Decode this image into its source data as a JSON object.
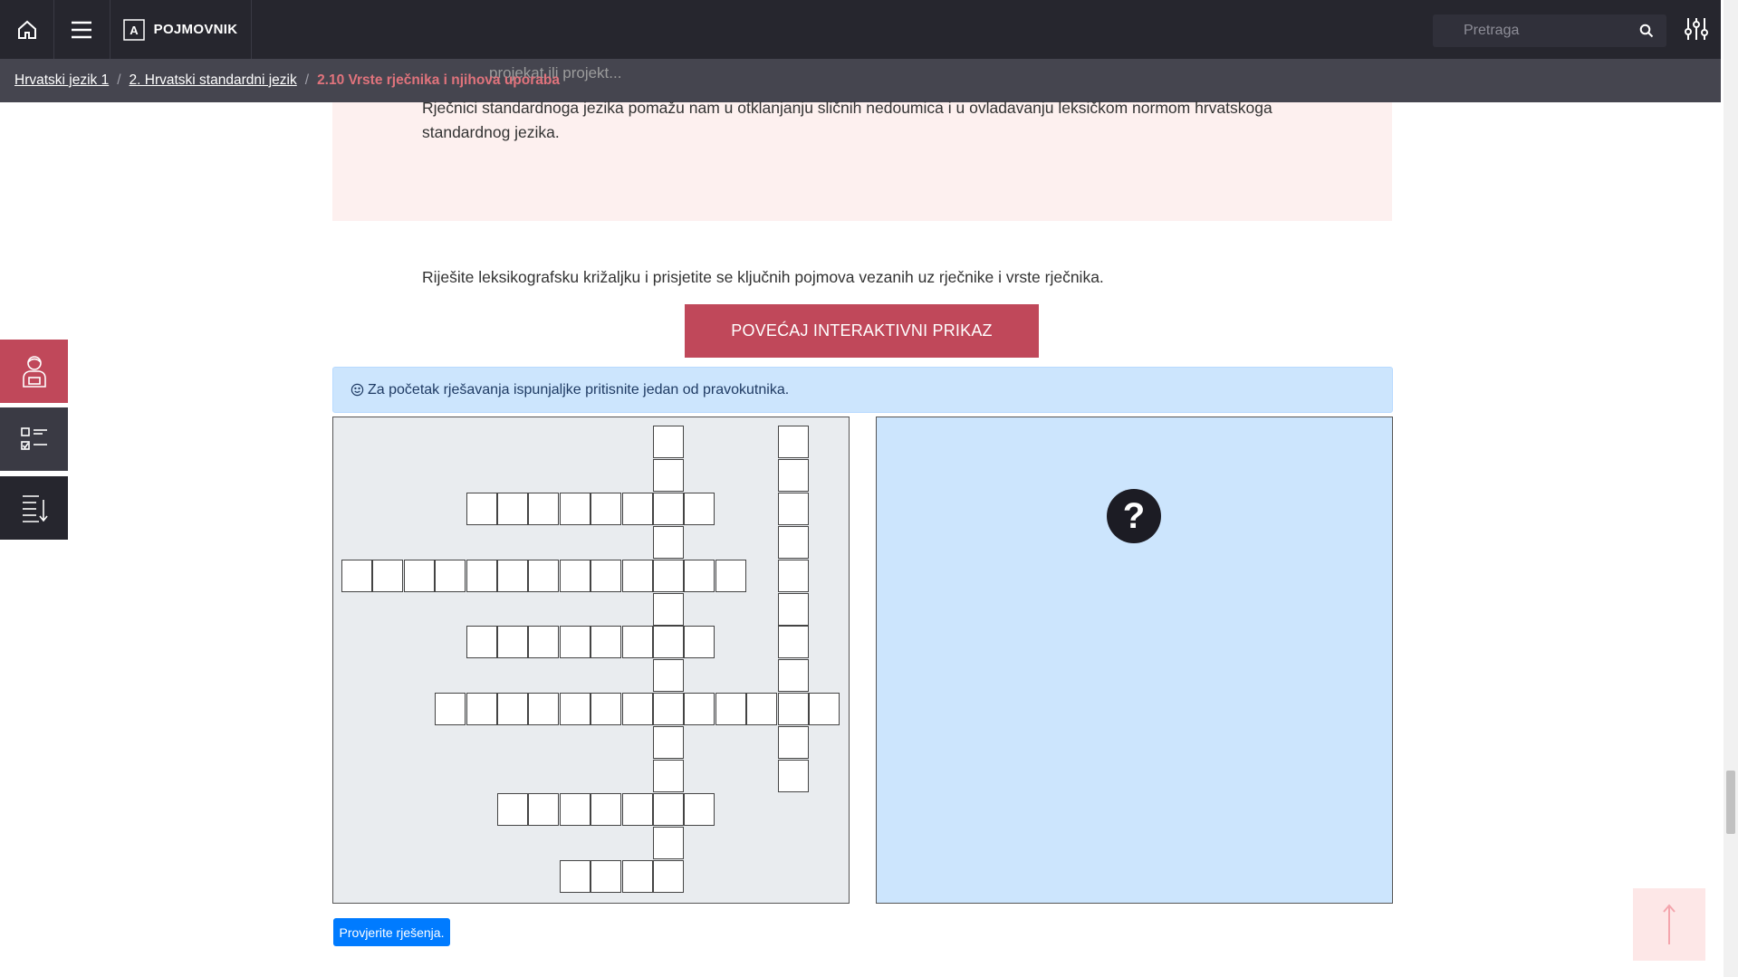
{
  "topbar": {
    "logo_label": "POJMOVNIK",
    "logo_letter": "A",
    "search_placeholder": "Pretraga"
  },
  "breadcrumb": {
    "items": [
      "Hrvatski jezik 1",
      "2. Hrvatski standardni jezik"
    ],
    "current": "2.10 Vrste rječnika i njihova uporaba",
    "separator": "/"
  },
  "content": {
    "ghost_text": "projekat ili projekt...",
    "box_text": "Rječnici standardnoga jezika pomažu nam u otklanjanju sličnih nedoumica i u ovladavanju leksičkom normom hrvatskoga standardnog jezika.",
    "intro": "Riješite leksikografsku križaljku i prisjetite se ključnih pojmova vezanih uz rječnike i vrste rječnika.",
    "enlarge_button": "POVEĆAJ INTERAKTIVNI PRIKAZ",
    "info_text": "Za početak rješavanja ispunjaljke pritisnite jedan od pravokutnika.",
    "check_button": "Provjerite rješenja."
  },
  "crossword": {
    "across": [
      {
        "row": 2,
        "col": 4,
        "length": 8
      },
      {
        "row": 4,
        "col": 0,
        "length": 13
      },
      {
        "row": 6,
        "col": 4,
        "length": 8
      },
      {
        "row": 8,
        "col": 3,
        "length": 13
      },
      {
        "row": 11,
        "col": 5,
        "length": 7
      },
      {
        "row": 13,
        "col": 7,
        "length": 4
      }
    ],
    "down": [
      {
        "row": 0,
        "col": 10,
        "length": 14
      },
      {
        "row": 0,
        "col": 14,
        "length": 11
      }
    ]
  },
  "sidebar_tools": [
    "student-icon",
    "checklist-icon",
    "sort-list-icon"
  ],
  "colors": {
    "accent": "#c0485a",
    "breadcrumb_current": "#e0737c",
    "info_bg": "#cce5fd",
    "primary_button": "#007bff"
  }
}
